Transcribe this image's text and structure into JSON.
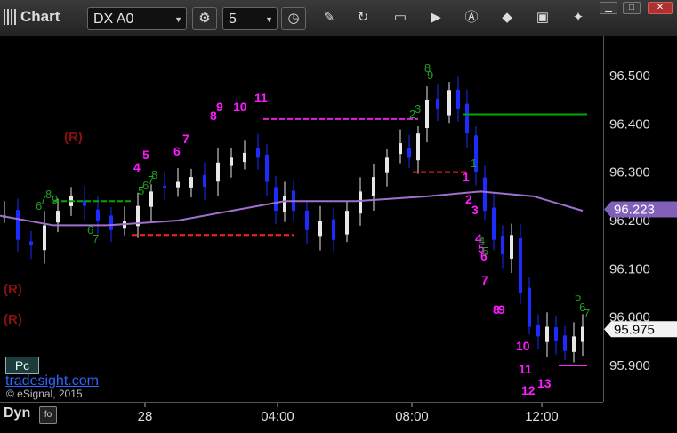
{
  "toolbar": {
    "title": "Chart",
    "symbol": "DX A0",
    "interval": "5"
  },
  "yaxis": {
    "ticks": [
      "96.500",
      "96.400",
      "96.300",
      "96.200",
      "96.100",
      "96.000",
      "95.900"
    ],
    "current_price_tag": "95.975",
    "average_tag": "96.223"
  },
  "xaxis": {
    "ticks": [
      "28",
      "04:00",
      "08:00",
      "12:00"
    ]
  },
  "overlay": {
    "pc_label": "Pc",
    "brand": "tradesight.com",
    "copyright": "© eSignal, 2015",
    "dyn_label": "Dyn"
  },
  "annotations": {
    "r_marks": [
      "(R)",
      "(R)",
      "(R)"
    ],
    "magenta_counts": [
      "4",
      "5",
      "6",
      "7",
      "8",
      "9",
      "10",
      "11",
      "12",
      "13",
      "1",
      "2",
      "3",
      "4",
      "5",
      "6",
      "7",
      "8",
      "9",
      "10",
      "11",
      "12",
      "13"
    ],
    "green_counts": [
      "6",
      "7",
      "8",
      "9",
      "5",
      "6",
      "7",
      "8",
      "9",
      "2",
      "3",
      "8",
      "9",
      "6",
      "7",
      "1",
      "4",
      "5",
      "5",
      "6",
      "7"
    ]
  },
  "chart_data": {
    "type": "candlestick",
    "y_range": [
      95.86,
      96.57
    ],
    "x_ticks": [
      "28",
      "04:00",
      "08:00",
      "12:00"
    ],
    "last_price": 95.975,
    "moving_average_last": 96.223,
    "levels": [
      {
        "color": "#00aa00",
        "y": 96.24
      },
      {
        "color": "#ff2222",
        "y": 96.17
      },
      {
        "color": "#dd22dd",
        "y": 96.41
      },
      {
        "color": "#ff2222",
        "y": 96.3
      },
      {
        "color": "#00aa00",
        "y": 96.42
      },
      {
        "color": "#ff22ff",
        "y": 95.9
      }
    ]
  },
  "colors": {
    "up": "#e8e8e8",
    "down": "#1a2cff",
    "avg": "#a070d0",
    "magenta": "#ff1aff",
    "green": "#1fa01f",
    "r": "#8a1010"
  }
}
